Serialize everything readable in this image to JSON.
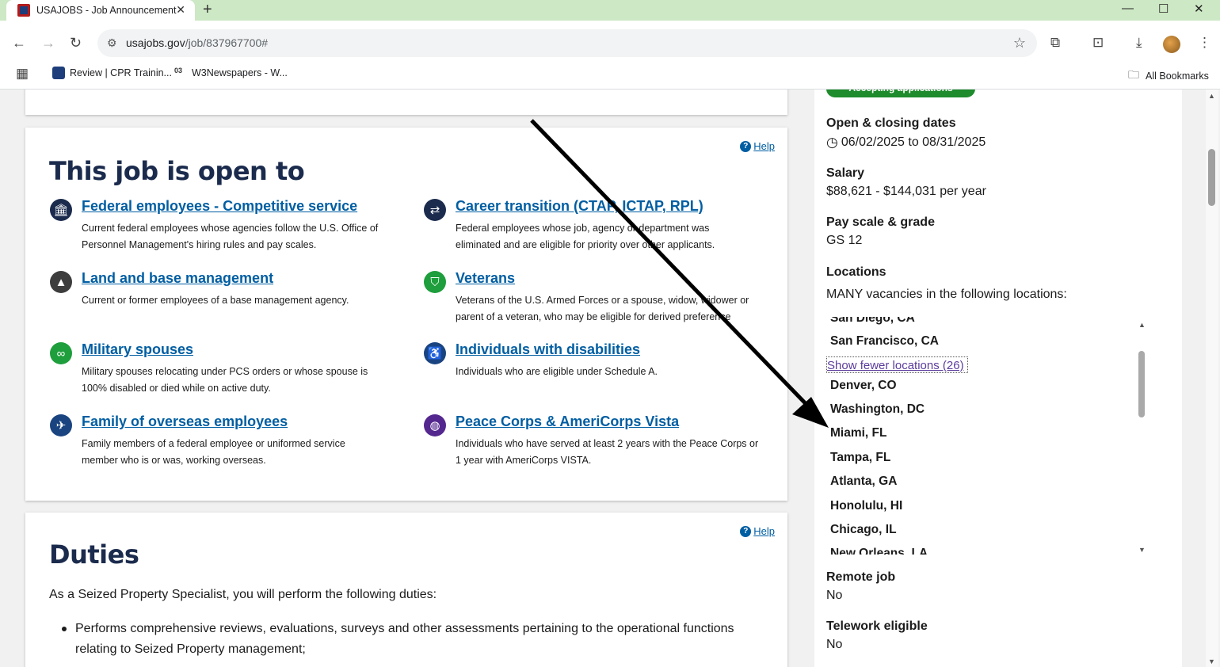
{
  "browser": {
    "tab_title": "USAJOBS - Job Announcement",
    "url_domain": "usajobs.gov",
    "url_path": "/job/837967700#",
    "bookmarks": [
      {
        "label": "Review | CPR Trainin..."
      },
      {
        "label": "W3Newspapers - W..."
      }
    ],
    "all_bookmarks": "All Bookmarks"
  },
  "open_to": {
    "title": "This job is open to",
    "help": "Help",
    "groups": [
      {
        "label": "Federal employees - Competitive service",
        "desc": "Current federal employees whose agencies follow the U.S. Office of Personnel Management's hiring rules and pay scales.",
        "icon": "building-icon"
      },
      {
        "label": "Career transition (CTAP, ICTAP, RPL)",
        "desc": "Federal employees whose job, agency or department was eliminated and are eligible for priority over other applicants.",
        "icon": "swap-arrows-icon"
      },
      {
        "label": "Land and base management",
        "desc": "Current or former employees of a base management agency.",
        "icon": "tree-icon"
      },
      {
        "label": "Veterans",
        "desc": "Veterans of the U.S. Armed Forces or a spouse, widow, widower or parent of a veteran, who may be eligible for derived preference",
        "icon": "shield-icon"
      },
      {
        "label": "Military spouses",
        "desc": "Military spouses relocating under PCS orders or whose spouse is 100% disabled or died while on active duty.",
        "icon": "rings-icon"
      },
      {
        "label": "Individuals with disabilities",
        "desc": "Individuals who are eligible under Schedule A.",
        "icon": "accessibility-icon"
      },
      {
        "label": "Family of overseas employees",
        "desc": "Family members of a federal employee or uniformed service member who is or was, working overseas.",
        "icon": "airplane-icon"
      },
      {
        "label": "Peace Corps & AmeriCorps Vista",
        "desc": "Individuals who have served at least 2 years with the Peace Corps or 1 year with AmeriCorps VISTA.",
        "icon": "globe-icon"
      }
    ]
  },
  "duties": {
    "title": "Duties",
    "help": "Help",
    "intro": "As a Seized Property Specialist, you will perform the following duties:",
    "items": [
      "Performs comprehensive reviews, evaluations, surveys and other assessments pertaining to the operational functions relating to Seized Property management;"
    ]
  },
  "sidebar": {
    "status": "Accepting applications",
    "dates_label": "Open & closing dates",
    "dates_value": "06/02/2025 to 08/31/2025",
    "salary_label": "Salary",
    "salary_value": "$88,621 - $144,031 per year",
    "grade_label": "Pay scale & grade",
    "grade_value": "GS 12",
    "locations_label": "Locations",
    "locations_intro": "MANY vacancies in the following locations:",
    "locations_before": [
      "San Diego, CA",
      "San Francisco, CA"
    ],
    "show_fewer": "Show fewer locations (26)",
    "locations_after": [
      "Denver, CO",
      "Washington, DC",
      "Miami, FL",
      "Tampa, FL",
      "Atlanta, GA",
      "Honolulu, HI",
      "Chicago, IL",
      "New Orleans, LA"
    ],
    "remote_label": "Remote job",
    "remote_value": "No",
    "telework_label": "Telework eligible",
    "telework_value": "No"
  }
}
